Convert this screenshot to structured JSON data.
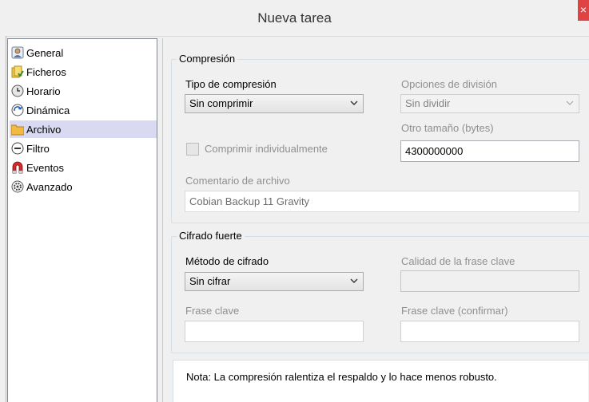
{
  "window": {
    "title": "Nueva tarea",
    "close_glyph": "×"
  },
  "sidebar": {
    "items": [
      {
        "label": "General",
        "icon": "user-icon"
      },
      {
        "label": "Ficheros",
        "icon": "files-icon"
      },
      {
        "label": "Horario",
        "icon": "clock-icon"
      },
      {
        "label": "Dinámica",
        "icon": "dynamic-icon"
      },
      {
        "label": "Archivo",
        "icon": "folder-icon",
        "selected": true
      },
      {
        "label": "Filtro",
        "icon": "filter-icon"
      },
      {
        "label": "Eventos",
        "icon": "magnet-icon"
      },
      {
        "label": "Avanzado",
        "icon": "gear-icon"
      }
    ]
  },
  "compression": {
    "group_title": "Compresión",
    "type_label": "Tipo de compresión",
    "type_value": "Sin comprimir",
    "split_label": "Opciones de división",
    "split_value": "Sin dividir",
    "other_size_label": "Otro tamaño (bytes)",
    "other_size_value": "4300000000",
    "compress_individually_label": "Comprimir individualmente",
    "compress_individually_checked": false,
    "comment_label": "Comentario de archivo",
    "comment_value": "Cobian Backup 11 Gravity"
  },
  "encryption": {
    "group_title": "Cifrado fuerte",
    "method_label": "Método de cifrado",
    "method_value": "Sin cifrar",
    "quality_label": "Calidad de la frase clave",
    "passphrase_label": "Frase clave",
    "passphrase_confirm_label": "Frase clave (confirmar)"
  },
  "note": "Nota: La compresión ralentiza el respaldo y lo hace menos robusto.",
  "colors": {
    "selected_item": "#d9d9f2",
    "close_button": "#e04343"
  }
}
